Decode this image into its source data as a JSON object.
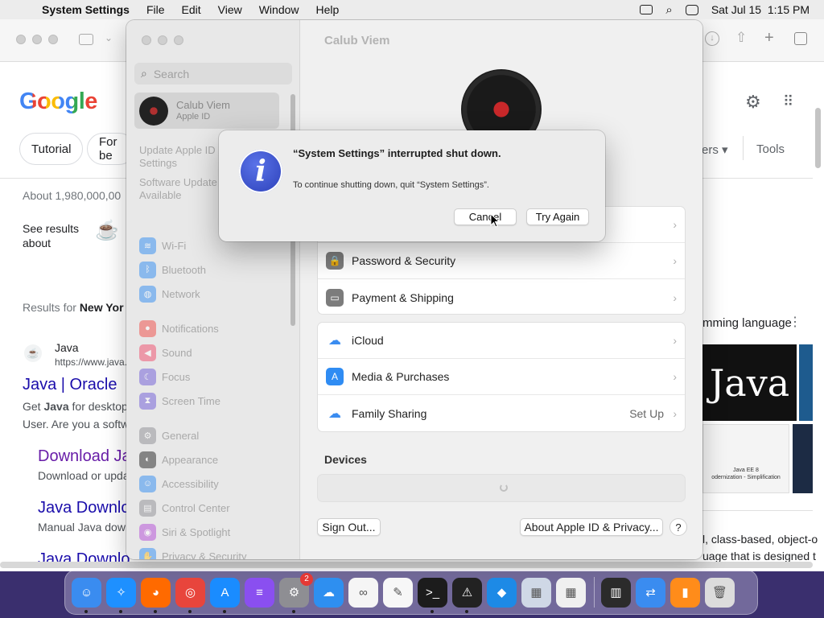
{
  "menubar": {
    "app": "System Settings",
    "items": [
      "File",
      "Edit",
      "View",
      "Window",
      "Help"
    ],
    "clock": "Sat Jul 15  1:15 PM"
  },
  "browser": {
    "logo": "Google",
    "chips": [
      "Tutorial",
      "For be"
    ],
    "filter_label": "ers",
    "tools": "Tools",
    "results_count": "About 1,980,000,00",
    "see_results": "See results",
    "see_results_2": "about",
    "results_for": "Results for",
    "results_for_place": "New Yor",
    "site_name": "Java",
    "site_url": "https://www.java.",
    "link1": "Java | Oracle",
    "snippet1a_pre": "Get ",
    "snippet1a_bold": "Java",
    "snippet1a_post": " for desktop",
    "snippet1b": "User. Are you a softw",
    "link2": "Download Ja",
    "snippet2": "Download or upda",
    "link3": "Java Downlo",
    "snippet3": "Manual Java dow",
    "link4": "Java Downlo",
    "kp_title": "mming language",
    "kp_java": "Java",
    "kp_ee_line1": "Java EE 8",
    "kp_ee_line2": "odernization - Simplification",
    "kp_snippet1": "l, class-based, object-o",
    "kp_snippet2": "uage that is designed t"
  },
  "settings": {
    "search_placeholder": "Search",
    "account_name": "Calub Viem",
    "account_sub": "Apple ID",
    "alert1": "Update Apple ID Settings",
    "alert2": "Software Update Available",
    "sidebar_items": [
      {
        "label": "Wi-Fi",
        "color": "#2f8cf3",
        "glyph": "≋"
      },
      {
        "label": "Bluetooth",
        "color": "#2f8cf3",
        "glyph": "ᛒ"
      },
      {
        "label": "Network",
        "color": "#2f8cf3",
        "glyph": "◍"
      },
      {
        "label": "Notifications",
        "color": "#f04a45",
        "glyph": "●"
      },
      {
        "label": "Sound",
        "color": "#f04a6a",
        "glyph": "◀"
      },
      {
        "label": "Focus",
        "color": "#6d5ad8",
        "glyph": "☾"
      },
      {
        "label": "Screen Time",
        "color": "#6d5ad8",
        "glyph": "⧗"
      },
      {
        "label": "General",
        "color": "#8e8e93",
        "glyph": "⚙"
      },
      {
        "label": "Appearance",
        "color": "#222222",
        "glyph": "◐"
      },
      {
        "label": "Accessibility",
        "color": "#2f8cf3",
        "glyph": "☺"
      },
      {
        "label": "Control Center",
        "color": "#8e8e93",
        "glyph": "▤"
      },
      {
        "label": "Siri & Spotlight",
        "color": "#b44ad8",
        "glyph": "◉"
      },
      {
        "label": "Privacy & Security",
        "color": "#2f8cf3",
        "glyph": "✋"
      }
    ],
    "content_title": "Calub Viem",
    "rows_group1": [
      {
        "label": "Password & Security",
        "color": "#7c7c7c",
        "glyph": "🔒"
      },
      {
        "label": "Payment & Shipping",
        "color": "#7c7c7c",
        "glyph": "▭"
      }
    ],
    "rows_group2": [
      {
        "label": "iCloud",
        "color": "#ffffff",
        "glyph": "☁"
      },
      {
        "label": "Media & Purchases",
        "color": "#2f8cf3",
        "glyph": "A"
      },
      {
        "label": "Family Sharing",
        "color": "#ffffff",
        "glyph": "☁",
        "value": "Set Up"
      }
    ],
    "devices_title": "Devices",
    "sign_out": "Sign Out...",
    "about": "About Apple ID & Privacy...",
    "help": "?"
  },
  "alert": {
    "title": "“System Settings” interrupted shut down.",
    "message": "To continue shutting down, quit “System Settings”.",
    "cancel": "Cancel",
    "try_again": "Try Again"
  },
  "dock": {
    "apps": [
      {
        "name": "finder",
        "color": "#3a8cf0",
        "glyph": "☺",
        "running": true
      },
      {
        "name": "safari",
        "color": "#1e90ff",
        "glyph": "✧",
        "running": true
      },
      {
        "name": "firefox",
        "color": "#ff6a00",
        "glyph": "◕",
        "running": true
      },
      {
        "name": "chrome",
        "color": "#e8453c",
        "glyph": "◎",
        "running": true
      },
      {
        "name": "app-store",
        "color": "#1a8cff",
        "glyph": "A",
        "running": true
      },
      {
        "name": "podcasts-alt",
        "color": "#8a4ff0",
        "glyph": "≡",
        "running": false
      },
      {
        "name": "system-settings",
        "color": "#8e8e93",
        "glyph": "⚙",
        "running": true,
        "badge": "2"
      },
      {
        "name": "weather",
        "color": "#2e8ff0",
        "glyph": "☁",
        "running": false
      },
      {
        "name": "visual-studio",
        "color": "#f5f5f5",
        "glyph": "∞",
        "running": false
      },
      {
        "name": "textedit",
        "color": "#f7f7f7",
        "glyph": "✎",
        "running": false
      },
      {
        "name": "terminal",
        "color": "#1c1c1c",
        "glyph": ">_",
        "running": true
      },
      {
        "name": "console",
        "color": "#222222",
        "glyph": "⚠",
        "running": true
      },
      {
        "name": "vscode",
        "color": "#1d8ae6",
        "glyph": "◆",
        "running": false
      },
      {
        "name": "preview",
        "color": "#cfd8e6",
        "glyph": "▦",
        "running": false
      },
      {
        "name": "launchpad",
        "color": "#f0f0f0",
        "glyph": "▦",
        "running": false
      }
    ],
    "apps_right": [
      {
        "name": "calculator",
        "color": "#2b2b2b",
        "glyph": "▥",
        "running": false
      },
      {
        "name": "migration",
        "color": "#3a8cf0",
        "glyph": "⇄",
        "running": false
      },
      {
        "name": "books",
        "color": "#ff8c1a",
        "glyph": "▮",
        "running": false
      },
      {
        "name": "trash",
        "color": "#dcdcdc",
        "glyph": "🗑",
        "running": false
      }
    ]
  }
}
